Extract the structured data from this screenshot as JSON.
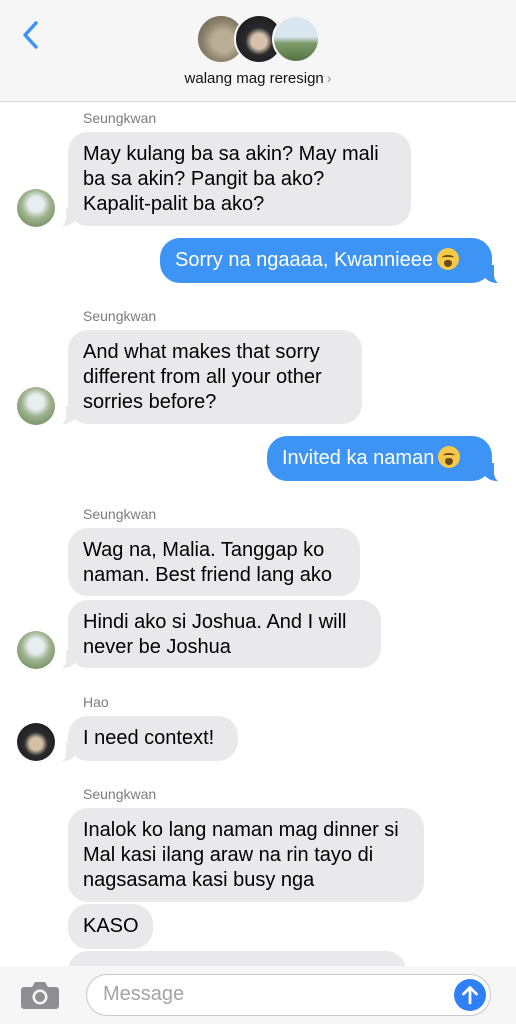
{
  "header": {
    "group_name": "walang mag reresign",
    "chevron": "›",
    "back_icon": "chevron-left-icon",
    "accent": "#3d94f5"
  },
  "messages": [
    {
      "sender": "Seungkwan",
      "text": "May kulang ba sa akin? May mali ba sa akin? Pangit ba ako? Kapalit-palit ba ako?"
    },
    {
      "outgoing": true,
      "text": "Sorry na ngaaaa, Kwannieee",
      "emoji": "crying-face-emoji"
    },
    {
      "sender": "Seungkwan",
      "text": "And what makes that sorry different from all your other sorries before?"
    },
    {
      "outgoing": true,
      "text": "Invited ka naman",
      "emoji": "crying-face-emoji"
    },
    {
      "sender": "Seungkwan",
      "text": "Wag na, Malia. Tanggap ko naman. Best friend lang ako"
    },
    {
      "sender": "Seungkwan",
      "text": "Hindi ako si Joshua. And I will never be Joshua"
    },
    {
      "sender": "Hao",
      "text": "I need context!"
    },
    {
      "sender": "Seungkwan",
      "text": "Inalok ko lang naman mag dinner si Mal kasi ilang araw na rin tayo di nagsasama kasi busy nga"
    },
    {
      "sender": "Seungkwan",
      "text": "KASO"
    }
  ],
  "input": {
    "placeholder": "Message",
    "camera_icon": "camera-icon",
    "send_icon": "send-arrow-icon"
  },
  "colors": {
    "incoming_bubble": "#e9e9eb",
    "outgoing_bubble": "#3d94f5",
    "send_button": "#2f7ff5"
  }
}
